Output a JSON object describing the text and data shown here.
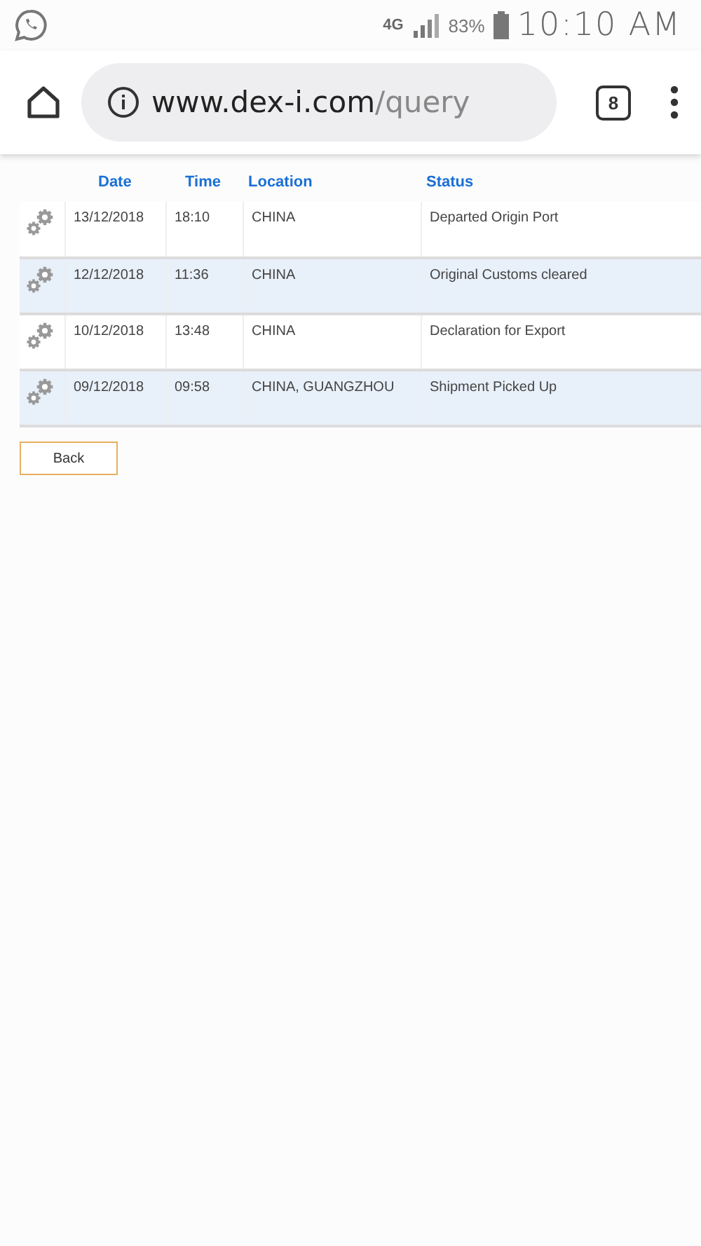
{
  "status_bar": {
    "network": "4G",
    "battery": "83%",
    "time": "10:10 AM"
  },
  "browser": {
    "url_host": "www.dex-i.com",
    "url_path": "/query",
    "tab_count": "8"
  },
  "table": {
    "columns": [
      "Date",
      "Time",
      "Location",
      "Status"
    ],
    "rows": [
      {
        "date": "13/12/2018",
        "time": "18:10",
        "location": "CHINA",
        "status": "Departed Origin Port"
      },
      {
        "date": "12/12/2018",
        "time": "11:36",
        "location": "CHINA",
        "status": "Original Customs cleared"
      },
      {
        "date": "10/12/2018",
        "time": "13:48",
        "location": "CHINA",
        "status": "Declaration for Export"
      },
      {
        "date": "09/12/2018",
        "time": "09:58",
        "location": "CHINA, GUANGZHOU",
        "status": "Shipment Picked Up"
      }
    ]
  },
  "back_button": "Back"
}
